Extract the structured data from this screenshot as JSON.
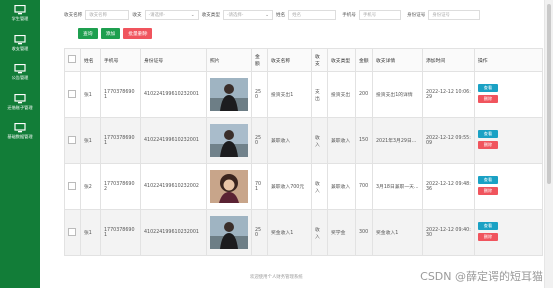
{
  "sidebar": {
    "items": [
      {
        "label": "学生管理"
      },
      {
        "label": "收支管理"
      },
      {
        "label": "公告管理"
      },
      {
        "label": "还借账子管理"
      },
      {
        "label": "基础数据管理"
      }
    ]
  },
  "filters": {
    "record_name_label": "收支名称",
    "record_name_placeholder": "收支名称",
    "type_label": "收支",
    "type_value": "-请选择-",
    "category_label": "收支类型",
    "category_value": "-请选择-",
    "name_label": "姓名",
    "name_placeholder": "姓名",
    "phone_label": "手机号",
    "phone_placeholder": "手机号",
    "id_label": "身份证号",
    "id_placeholder": "身份证号"
  },
  "actions": {
    "search": "查询",
    "add": "添加",
    "batch_delete": "批量删除"
  },
  "table": {
    "headers": [
      "",
      "姓名",
      "手机号",
      "身份证号",
      "照片",
      "金额",
      "收支名称",
      "收支",
      "收支类型",
      "金额",
      "收支详情",
      "添加时间",
      "操作"
    ],
    "rows": [
      {
        "name": "张1",
        "phone": "17703786901",
        "idno": "410224199610232001",
        "amount": "250",
        "record": "投资支出1",
        "io": "支出",
        "type": "投资支出",
        "amount2": "200",
        "detail": "投资支出1的详情",
        "time": "2022-12-12 10:06:29"
      },
      {
        "name": "张1",
        "phone": "17703786901",
        "idno": "410224199610232001",
        "amount": "250",
        "record": "兼职收入",
        "io": "收入",
        "type": "兼职收入",
        "amount2": "150",
        "detail": "2021年3月29日...",
        "time": "2022-12-12 09:55:09"
      },
      {
        "name": "张2",
        "phone": "17703786902",
        "idno": "410224199610232002",
        "amount": "701",
        "record": "兼职收入700元",
        "io": "收入",
        "type": "兼职收入",
        "amount2": "700",
        "detail": "3月18日兼职一天...",
        "time": "2022-12-12 09:48:36"
      },
      {
        "name": "张1",
        "phone": "17703786901",
        "idno": "410224199610232001",
        "amount": "250",
        "record": "奖金收入1",
        "io": "收入",
        "type": "奖学金",
        "amount2": "300",
        "detail": "奖金收入1",
        "time": "2022-12-12 09:40:30"
      }
    ],
    "view_label": "查看",
    "delete_label": "删除"
  },
  "footer": "欢迎使用个人财务管理系统",
  "watermark": "CSDN @薛定谔的短耳猫",
  "colors": {
    "sidebar": "#127d38",
    "search": "#1e9f4f",
    "add": "#1e9f4f",
    "batch_delete": "#f0545d",
    "view": "#1aa1c4",
    "delete": "#f0545d"
  }
}
